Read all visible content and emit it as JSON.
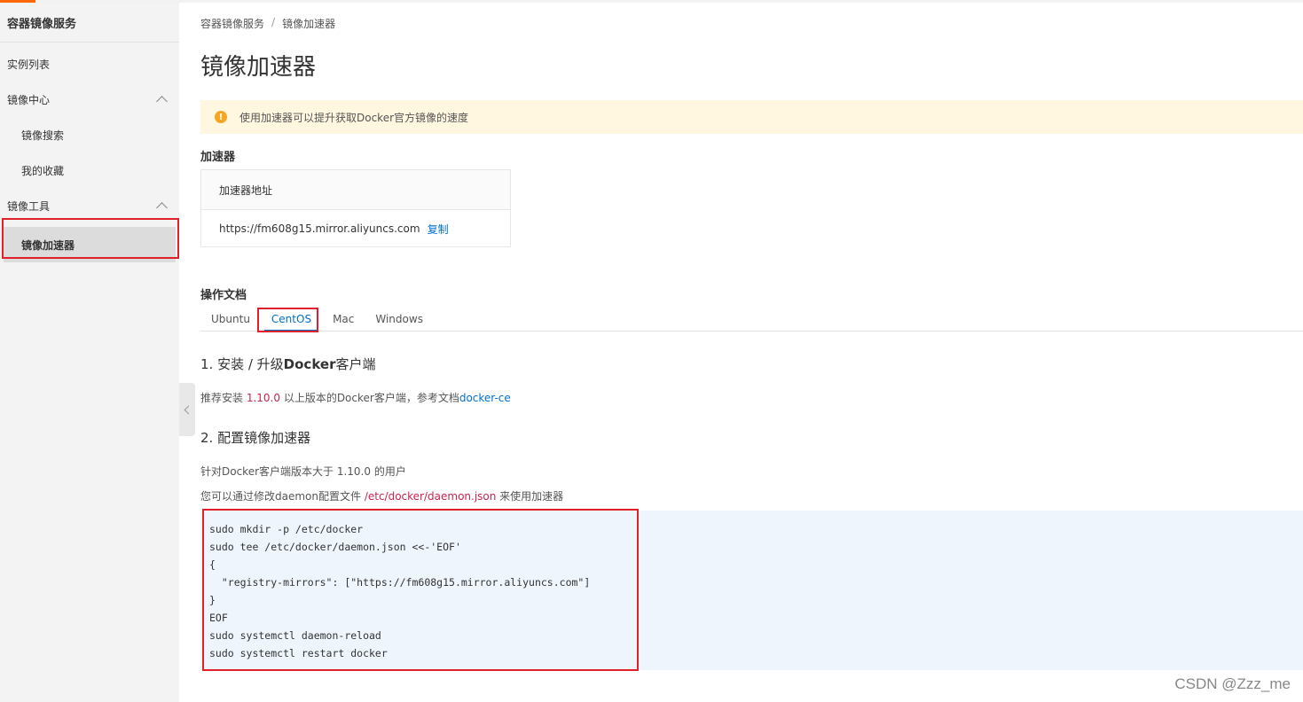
{
  "sidebar": {
    "title": "容器镜像服务",
    "items": [
      {
        "label": "实例列表"
      },
      {
        "label": "镜像中心"
      },
      {
        "label": "镜像搜索"
      },
      {
        "label": "我的收藏"
      },
      {
        "label": "镜像工具"
      },
      {
        "label": "镜像加速器"
      }
    ]
  },
  "breadcrumb": {
    "root": "容器镜像服务",
    "separator": "/",
    "current": "镜像加速器"
  },
  "page_title": "镜像加速器",
  "notice": {
    "icon": "!",
    "text": "使用加速器可以提升获取Docker官方镜像的速度"
  },
  "accelerator": {
    "section_label": "加速器",
    "header": "加速器地址",
    "address": "https://fm608g15.mirror.aliyuncs.com",
    "copy_label": "复制"
  },
  "docs": {
    "section_label": "操作文档",
    "tabs": [
      "Ubuntu",
      "CentOS",
      "Mac",
      "Windows"
    ],
    "active_tab": "CentOS"
  },
  "step1": {
    "title_prefix": "1. 安装 / 升级",
    "title_bold": "Docker",
    "title_suffix": "客户端",
    "text_before": "推荐安装 ",
    "version": "1.10.0",
    "text_after": " 以上版本的Docker客户端，参考文档",
    "doc_link": "docker-ce"
  },
  "step2": {
    "title": "2. 配置镜像加速器",
    "line1": "针对Docker客户端版本大于 1.10.0 的用户",
    "line2_before": "您可以通过修改daemon配置文件 ",
    "config_path": "/etc/docker/daemon.json",
    "line2_after": " 来使用加速器"
  },
  "code": {
    "lines": [
      "sudo mkdir -p /etc/docker",
      "sudo tee /etc/docker/daemon.json <<-'EOF'",
      "{",
      "  \"registry-mirrors\": [\"https://fm608g15.mirror.aliyuncs.com\"]",
      "}",
      "EOF",
      "sudo systemctl daemon-reload",
      "sudo systemctl restart docker"
    ]
  },
  "watermark": "CSDN @Zzz_me",
  "colors": {
    "accent": "#ff6a00",
    "link": "#0070cc",
    "highlight": "#e0202a",
    "notice_bg": "#fff7e0",
    "code_bg": "#eef5fc"
  }
}
